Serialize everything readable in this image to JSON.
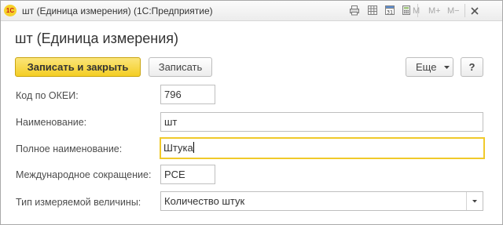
{
  "window": {
    "title": "шт (Единица измерения)  (1С:Предприятие)",
    "logo_text": "1С",
    "toolbar": {
      "m": "M",
      "m_plus": "M+",
      "m_minus": "M−",
      "calendar_day": "31"
    }
  },
  "form": {
    "caption": "шт (Единица измерения)",
    "commands": {
      "save_close": "Записать и закрыть",
      "save": "Записать",
      "more": "Еще",
      "help": "?"
    },
    "fields": {
      "okei_code": {
        "label": "Код по ОКЕИ:",
        "value": "796"
      },
      "name": {
        "label": "Наименование:",
        "value": "шт"
      },
      "full_name": {
        "label": "Полное наименование:",
        "value": "Штука"
      },
      "intl_abbr": {
        "label": "Международное сокращение:",
        "value": "PCE"
      },
      "quantity_type": {
        "label": "Тип измеряемой величины:",
        "value": "Количество штук"
      }
    }
  },
  "colors": {
    "accent_yellow": "#f4ce24",
    "focus_border": "#f0c92a"
  },
  "icons": [
    "print-icon",
    "grid-icon",
    "calendar-icon",
    "calculator-icon",
    "close-icon",
    "chevron-down-icon"
  ]
}
